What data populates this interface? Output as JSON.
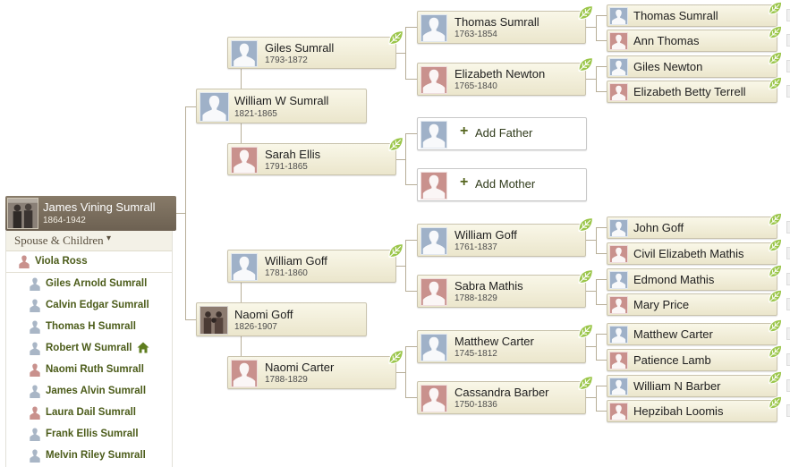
{
  "root": {
    "name": "James Vining Sumrall",
    "dates": "1864-1942"
  },
  "father": {
    "name": "William W Sumrall",
    "dates": "1821-1865"
  },
  "mother": {
    "name": "Naomi Goff",
    "dates": "1826-1907"
  },
  "gen3": {
    "ff": {
      "name": "Giles Sumrall",
      "dates": "1793-1872"
    },
    "fm": {
      "name": "Sarah Ellis",
      "dates": "1791-1865"
    },
    "mf": {
      "name": "William Goff",
      "dates": "1781-1860"
    },
    "mm": {
      "name": "Naomi Carter",
      "dates": "1788-1829"
    }
  },
  "gen4": {
    "fff": {
      "name": "Thomas Sumrall",
      "dates": "1763-1854"
    },
    "ffm": {
      "name": "Elizabeth Newton",
      "dates": "1765-1840"
    },
    "mff": {
      "name": "William Goff",
      "dates": "1761-1837"
    },
    "mfm": {
      "name": "Sabra Mathis",
      "dates": "1788-1829"
    },
    "mmf": {
      "name": "Matthew Carter",
      "dates": "1745-1812"
    },
    "mmm": {
      "name": "Cassandra Barber",
      "dates": "1750-1836"
    }
  },
  "add": {
    "father": "Add Father",
    "mother": "Add Mother"
  },
  "gen5": [
    "Thomas Sumrall",
    "Ann Thomas",
    "Giles Newton",
    "Elizabeth Betty Terrell",
    "John Goff",
    "Civil Elizabeth Mathis",
    "Edmond Mathis",
    "Mary Price",
    "Matthew Carter",
    "Patience Lamb",
    "William N Barber",
    "Hepzibah Loomis"
  ],
  "sidebar": {
    "title": "Spouse & Children",
    "caret": "▾",
    "spouse": "Viola Ross",
    "children": [
      "Giles Arnold Sumrall",
      "Calvin Edgar Sumrall",
      "Thomas H Sumrall",
      "Robert W Sumrall",
      "Naomi Ruth Sumrall",
      "James Alvin Sumrall",
      "Laura Dail Sumrall",
      "Frank Ellis Sumrall",
      "Melvin Riley Sumrall"
    ]
  },
  "colors": {
    "male": "#9fb1c8",
    "female": "#c9918d",
    "link": "#4c5c1a",
    "leaf": "#8fbf3f"
  },
  "icons": {
    "hint": "leaf-hint-icon",
    "home": "home-icon",
    "person": "person-silhouette-icon"
  }
}
